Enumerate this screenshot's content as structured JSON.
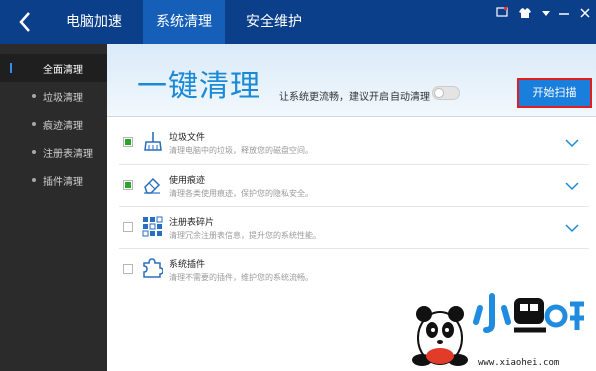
{
  "tabs": [
    {
      "label": "电脑加速"
    },
    {
      "label": "系统清理"
    },
    {
      "label": "安全维护"
    }
  ],
  "window_controls": [
    "notification-icon",
    "shirt-icon",
    "menu-icon",
    "minimize-icon",
    "close-icon"
  ],
  "sidebar": {
    "items": [
      {
        "label": "全面清理",
        "active": true
      },
      {
        "label": "垃圾清理"
      },
      {
        "label": "痕迹清理"
      },
      {
        "label": "注册表清理"
      },
      {
        "label": "插件清理"
      }
    ]
  },
  "header": {
    "title": "一键清理",
    "subtitle": "让系统更流畅，建议开启",
    "auto_clean_label": "自动清理",
    "auto_clean_on": false,
    "scan_button": "开始扫描"
  },
  "rows": [
    {
      "title": "垃圾文件",
      "desc": "清理电脑中的垃圾，释放您的磁盘空间。",
      "checked": true,
      "icon": "broom-icon",
      "expandable": true
    },
    {
      "title": "使用痕迹",
      "desc": "清理各类使用痕迹，保护您的隐私安全。",
      "checked": true,
      "icon": "eraser-icon",
      "expandable": true
    },
    {
      "title": "注册表碎片",
      "desc": "清理冗余注册表信息，提升您的系统性能。",
      "checked": false,
      "icon": "registry-grid-icon",
      "expandable": true
    },
    {
      "title": "系统插件",
      "desc": "清理不需要的插件，维护您的系统流畅。",
      "checked": false,
      "icon": "puzzle-icon",
      "expandable": false
    }
  ],
  "watermark": {
    "url": "www.xiaohei.com"
  },
  "colors": {
    "topbar": "#0b3f8a",
    "active_tab": "#155fb8",
    "sidebar": "#2b2b2b",
    "accent": "#1b8ad6",
    "scan_button": "#1a7fdc",
    "check_green": "#2aa52a"
  }
}
